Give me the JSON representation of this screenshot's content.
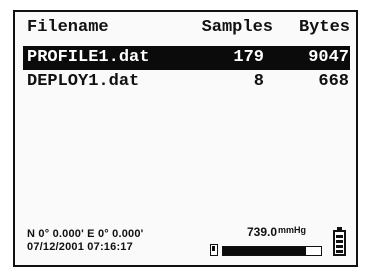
{
  "headers": {
    "filename": "Filename",
    "samples": "Samples",
    "bytes": "Bytes"
  },
  "files": [
    {
      "name": "PROFILE1.dat",
      "samples": "179",
      "bytes": "9047",
      "selected": true
    },
    {
      "name": "DEPLOY1.dat",
      "samples": "8",
      "bytes": "668",
      "selected": false
    }
  ],
  "status": {
    "coordinates": "N 0° 0.000' E 0° 0.000'",
    "datetime": "07/12/2001 07:16:17",
    "pressure_value": "739.0",
    "pressure_unit": "mmHg",
    "memory_used_fraction": 0.85
  },
  "icons": {
    "memory": "memory-card-icon",
    "battery": "battery-icon"
  }
}
